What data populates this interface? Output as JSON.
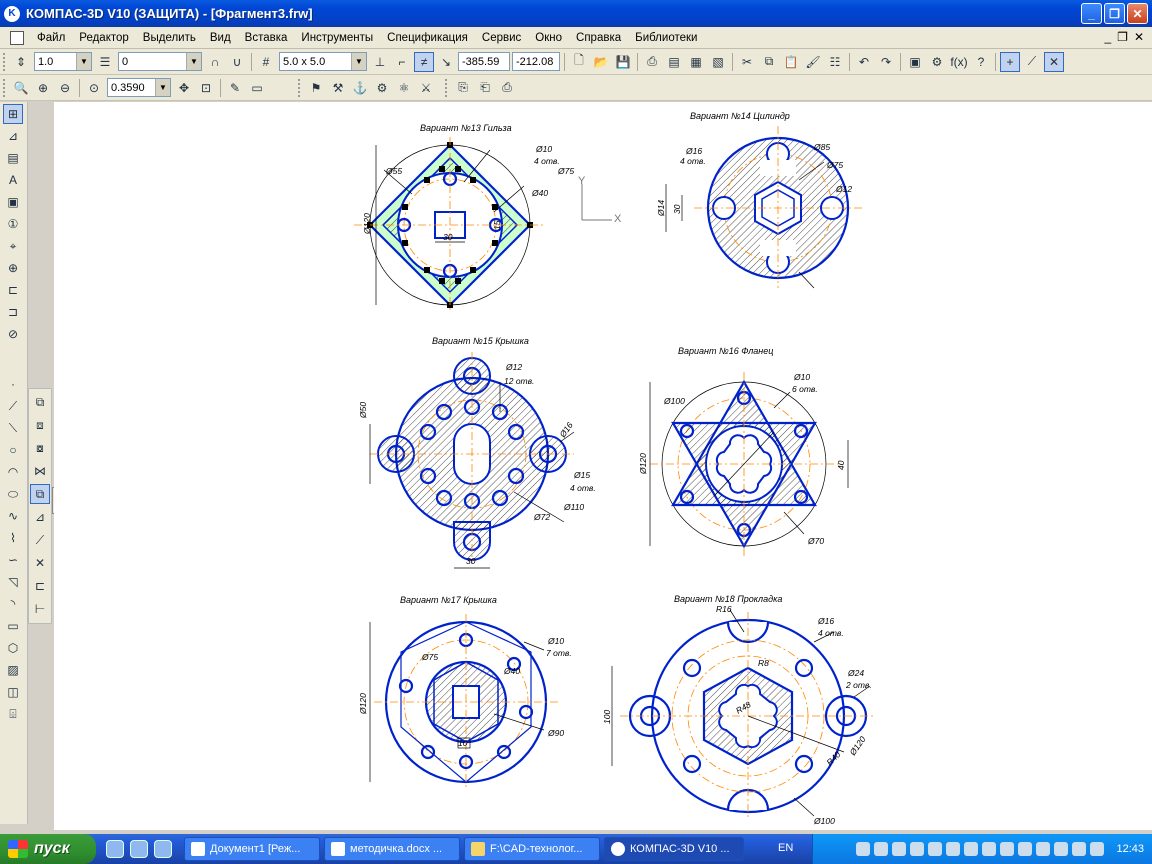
{
  "window": {
    "title": "КОМПАС-3D V10 (ЗАЩИТА) - [Фрагмент3.frw]",
    "app_icon": "K"
  },
  "menu": [
    "Файл",
    "Редактор",
    "Выделить",
    "Вид",
    "Вставка",
    "Инструменты",
    "Спецификация",
    "Сервис",
    "Окно",
    "Справка",
    "Библиотеки"
  ],
  "toolbar": {
    "line_scale": "1.0",
    "layer": "0",
    "grid_step": "5.0 x 5.0",
    "coord_x": "-385.59",
    "coord_y": "-212.08",
    "zoom": "0.3590"
  },
  "axes": {
    "y_label": "Y",
    "x_label": "X"
  },
  "drawings": {
    "v13": {
      "title": "Вариант №13  Гильза",
      "dims": [
        "Ø10",
        "4 отв.",
        "Ø75",
        "Ø40",
        "Ø55",
        "Ø120",
        "15",
        "30"
      ]
    },
    "v14": {
      "title": "Вариант №14  Цилиндр",
      "dims": [
        "Ø16",
        "4 отв.",
        "Ø85",
        "Ø75",
        "Ø12",
        "Ø14",
        "30"
      ]
    },
    "v15": {
      "title": "Вариант №15  Крышка",
      "dims": [
        "Ø12",
        "12 отв.",
        "Ø50",
        "Ø16",
        "Ø15",
        "4 отв.",
        "Ø72",
        "Ø110",
        "30"
      ]
    },
    "v16": {
      "title": "Вариант №16  Фланец",
      "dims": [
        "Ø10",
        "6 отв.",
        "Ø100",
        "Ø120",
        "40",
        "Ø70"
      ]
    },
    "v17": {
      "title": "Вариант №17  Крышка",
      "dims": [
        "Ø10",
        "7 отв.",
        "Ø75",
        "Ø40",
        "Ø120",
        "Ø90",
        "10"
      ]
    },
    "v18": {
      "title": "Вариант №18  Прокладка",
      "dims": [
        "R16",
        "Ø16",
        "4 отв.",
        "Ø24",
        "2 отв.",
        "R8",
        "Ø120",
        "Ø100",
        "R40",
        "100",
        "R48"
      ]
    }
  },
  "taskbar": {
    "start": "пуск",
    "tasks": [
      "Документ1 [Реж...",
      "методичка.docx ...",
      "F:\\CAD-технолог...",
      "КОМПАС-3D V10 ..."
    ],
    "lang": "EN",
    "clock": "12:43"
  },
  "colors": {
    "outline": "#0022cc",
    "center": "#ff8800",
    "fill": "#ccffcc",
    "dim": "#000000"
  }
}
